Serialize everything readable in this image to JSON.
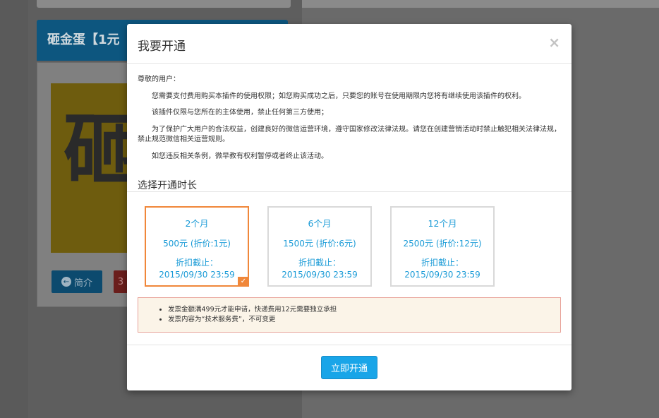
{
  "background": {
    "header_title": "砸金蛋【1元",
    "image_glyph": "砸",
    "intro_button": "简介",
    "intro_icon": "←",
    "red_button_glyph": "3"
  },
  "modal": {
    "title": "我要开通",
    "close_glyph": "×",
    "terms": {
      "greeting": "尊敬的用户：",
      "p1": "您需要支付费用购买本插件的使用权限；如您购买成功之后，只要您的账号在使用期限内您将有继续使用该插件的权利。",
      "p2": "该插件仅限与您所在的主体使用，禁止任何第三方使用；",
      "p3": "为了保护广大用户的合法权益，创建良好的微信运营环境，遵守国家修改法律法规。请您在创建营销活动时禁止触犯相关法律法规，禁止规范微信相关运营规则。",
      "p4": "如您违反相关条例，微早教有权利暂停或者终止该活动。"
    },
    "section_title": "选择开通时长",
    "plans": [
      {
        "months": "2个月",
        "price": "500元 (折价:1元)",
        "deadline": "折扣截止：2015/09/30 23:59",
        "selected": true
      },
      {
        "months": "6个月",
        "price": "1500元 (折价:6元)",
        "deadline": "折扣截止：2015/09/30 23:59",
        "selected": false
      },
      {
        "months": "12个月",
        "price": "2500元 (折价:12元)",
        "deadline": "折扣截止：2015/09/30 23:59",
        "selected": false
      }
    ],
    "check_glyph": "✓",
    "notice": [
      "发票金额满499元才能申请，快递费用12元需要独立承担",
      "发票内容为“技术服务费”，不可变更"
    ],
    "submit_label": "立即开通"
  },
  "colors": {
    "accent": "#19a5e8",
    "selected_border": "#f0873a",
    "plan_text": "#1a9bd7",
    "notice_bg": "#fbf4e8",
    "notice_border": "#e8a39a"
  }
}
